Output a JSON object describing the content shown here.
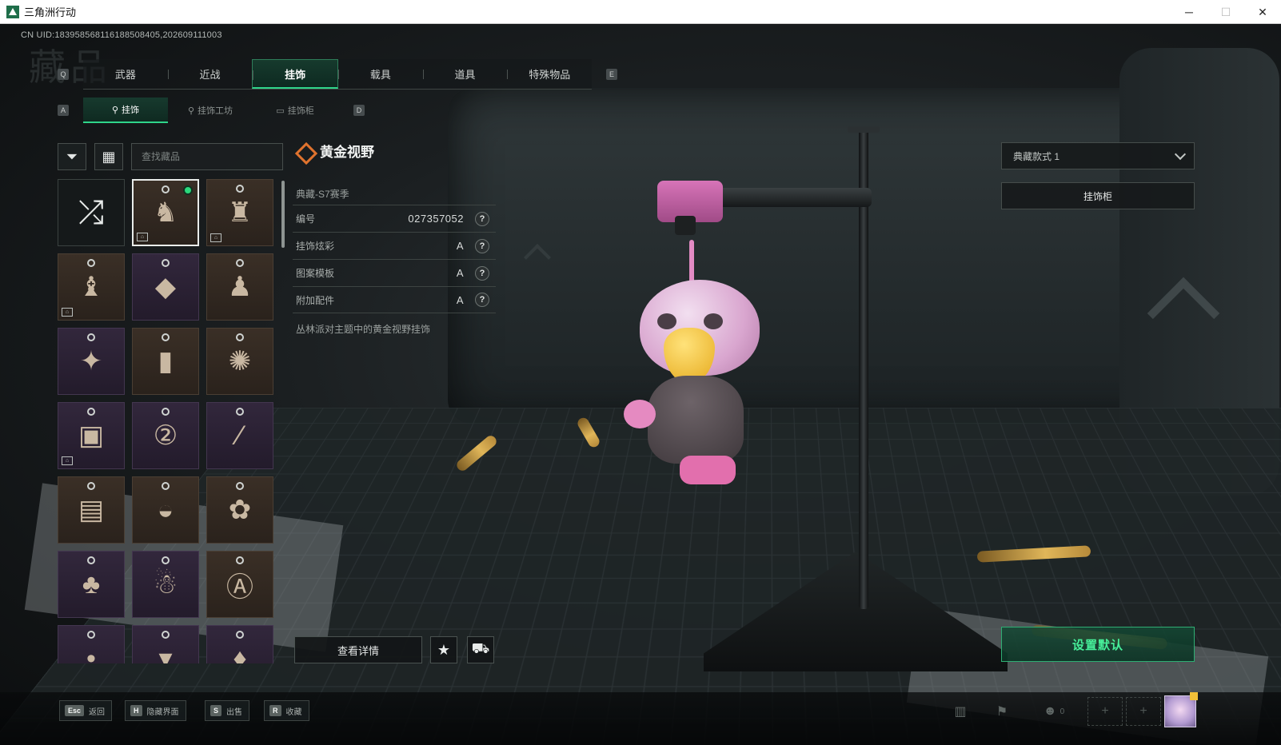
{
  "window": {
    "title": "三角洲行动",
    "controls": {
      "minimize": "─",
      "maximize": "☐",
      "close": "✕"
    }
  },
  "uid_text": "CN UID:183958568116188508405,202609111003",
  "page_title": "藏品",
  "main_tabs": {
    "left_key": "Q",
    "right_key": "E",
    "items": [
      "武器",
      "近战",
      "挂饰",
      "载具",
      "道具",
      "特殊物品"
    ],
    "active": "挂饰"
  },
  "sub_tabs": {
    "left_key": "A",
    "right_key": "D",
    "items": [
      "挂饰",
      "挂饰工坊",
      "挂饰柜"
    ],
    "active": "挂饰"
  },
  "toolbar": {
    "filter_icon": "filter-icon",
    "view_icon": "grid-view-icon",
    "search_placeholder": "查找藏品"
  },
  "item_grid": {
    "items": [
      {
        "kind": "random",
        "glyph": "⤮",
        "tone": "dark"
      },
      {
        "kind": "charm",
        "glyph": "♞",
        "tone": "brown",
        "selected": true,
        "equipped": true,
        "has_preview": true
      },
      {
        "kind": "charm",
        "glyph": "♜",
        "tone": "brown",
        "has_preview": true
      },
      {
        "kind": "charm",
        "glyph": "♝",
        "tone": "brown",
        "has_preview": true
      },
      {
        "kind": "charm",
        "glyph": "◆",
        "tone": "purple"
      },
      {
        "kind": "charm",
        "glyph": "♟",
        "tone": "brown"
      },
      {
        "kind": "charm",
        "glyph": "✦",
        "tone": "purple"
      },
      {
        "kind": "charm",
        "glyph": "▮",
        "tone": "brown"
      },
      {
        "kind": "charm",
        "glyph": "✺",
        "tone": "brown"
      },
      {
        "kind": "charm",
        "glyph": "▣",
        "tone": "purple",
        "has_preview": true
      },
      {
        "kind": "charm",
        "glyph": "②",
        "tone": "purple"
      },
      {
        "kind": "charm",
        "glyph": "⁄",
        "tone": "purple"
      },
      {
        "kind": "charm",
        "glyph": "▤",
        "tone": "brown"
      },
      {
        "kind": "charm",
        "glyph": "◒",
        "tone": "brown"
      },
      {
        "kind": "charm",
        "glyph": "✿",
        "tone": "brown"
      },
      {
        "kind": "charm",
        "glyph": "♣",
        "tone": "purple"
      },
      {
        "kind": "charm",
        "glyph": "☃",
        "tone": "purple"
      },
      {
        "kind": "charm",
        "glyph": "Ⓐ",
        "tone": "brown"
      },
      {
        "kind": "charm",
        "glyph": "•",
        "tone": "purple"
      },
      {
        "kind": "charm",
        "glyph": "▾",
        "tone": "purple"
      },
      {
        "kind": "charm",
        "glyph": "♦",
        "tone": "purple"
      }
    ],
    "preview_badge": "⌂"
  },
  "detail": {
    "name": "黄金视野",
    "season": "典藏-S7赛季",
    "rows": [
      {
        "label": "编号",
        "value": "027357052",
        "help": "?"
      },
      {
        "label": "挂饰炫彩",
        "value": "A",
        "help": "?"
      },
      {
        "label": "图案模板",
        "value": "A",
        "help": "?"
      },
      {
        "label": "附加配件",
        "value": "A",
        "help": "?"
      }
    ],
    "description": "丛林派对主题中的黄金视野挂饰",
    "view_detail_label": "查看详情",
    "favorite_icon": "★",
    "cart_icon": "⛟"
  },
  "right_panel": {
    "style_select": "典藏款式 1",
    "cabinet_label": "挂饰柜",
    "set_default_label": "设置默认"
  },
  "bottom_hints": [
    {
      "key": "Esc",
      "label": "返回"
    },
    {
      "key": "H",
      "label": "隐藏界面"
    },
    {
      "key": "S",
      "label": "出售"
    },
    {
      "key": "R",
      "label": "收藏"
    }
  ],
  "tray": {
    "stats_icon": "▥",
    "flag_icon": "⚑",
    "friends_icon": "☻",
    "friends_count": "0",
    "slot_plus": "+"
  }
}
